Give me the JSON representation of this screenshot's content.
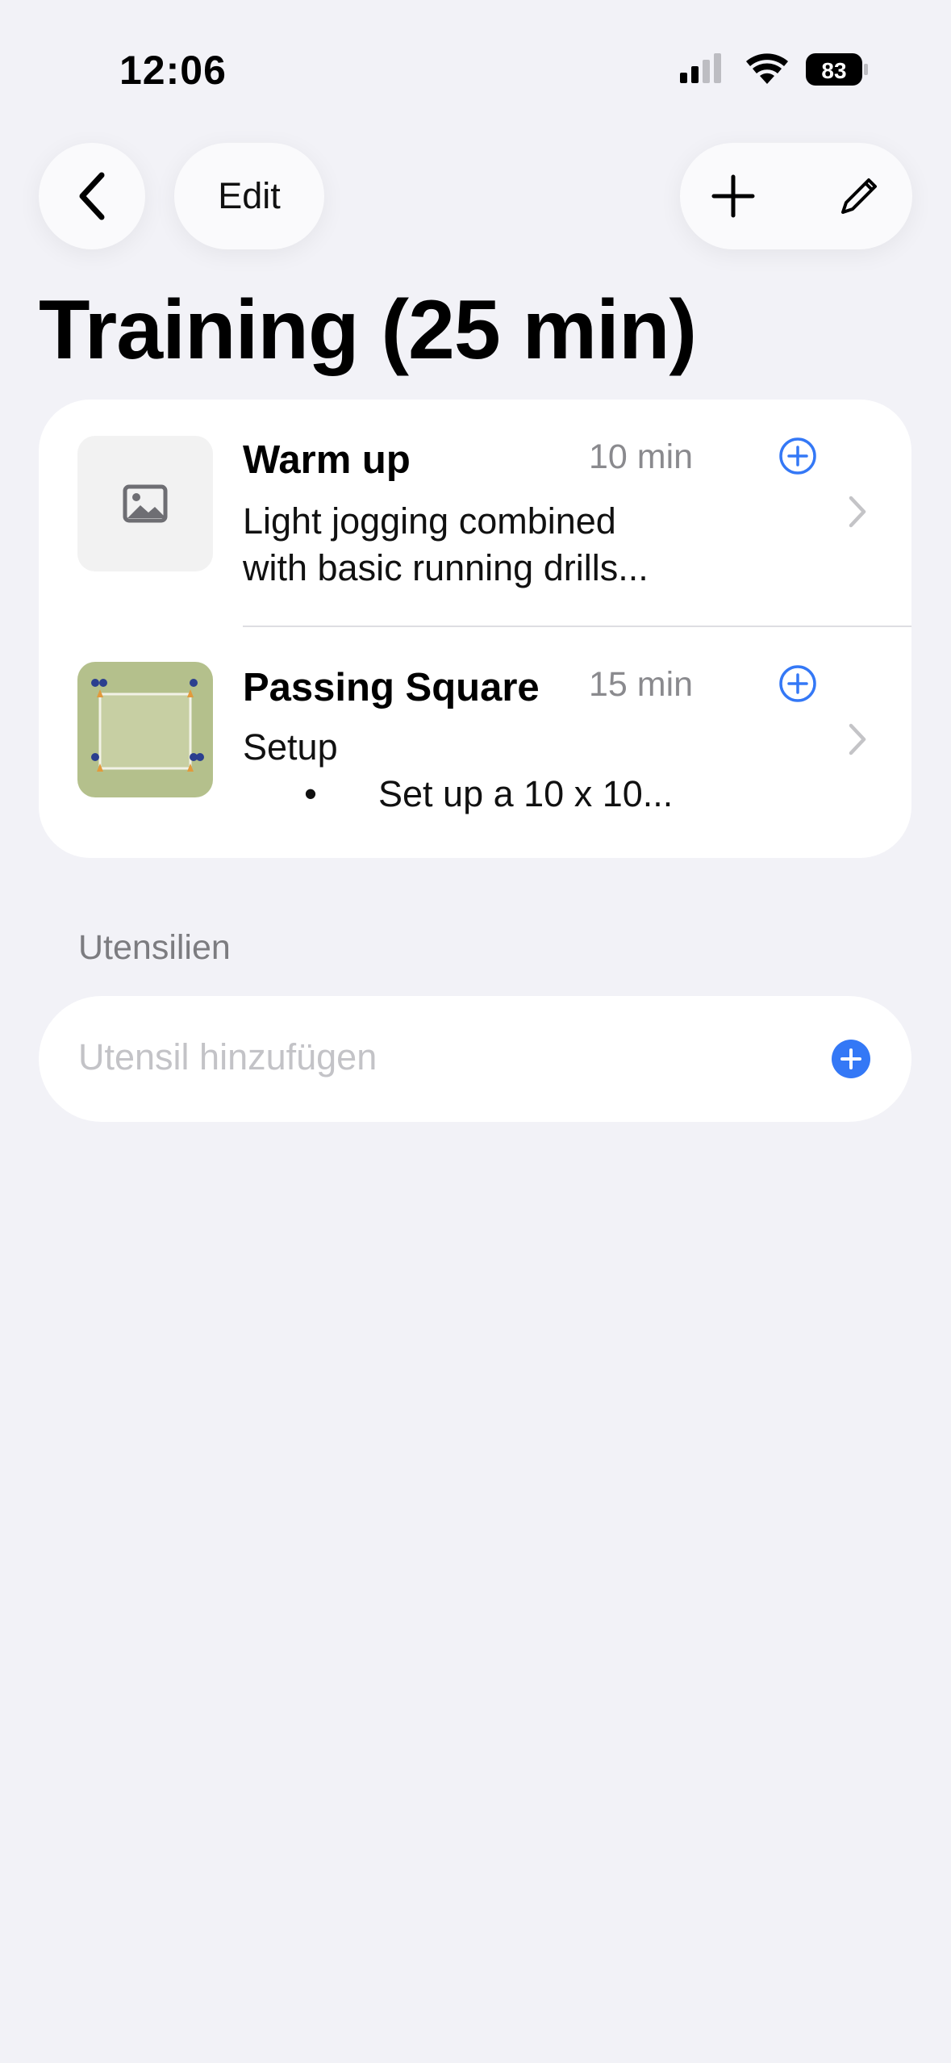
{
  "status_bar": {
    "time": "12:06",
    "battery": "83",
    "icons": [
      "cellular-signal-icon",
      "wifi-icon",
      "battery-icon"
    ]
  },
  "nav": {
    "back_icon": "chevron-left-icon",
    "edit_label": "Edit",
    "add_icon": "plus-icon",
    "pencil_icon": "pencil-icon"
  },
  "page": {
    "title": "Training (25 min)"
  },
  "exercises": [
    {
      "title": "Warm up",
      "duration": "10 min",
      "description_lines": [
        "Light jogging combined",
        "with basic running drills..."
      ],
      "thumbnail": "image-placeholder-icon"
    },
    {
      "title": "Passing Square",
      "duration": "15 min",
      "description_line1": "Setup",
      "bullet": "•",
      "bullet_text": "Set up a 10 x 10...",
      "thumbnail": "passing-square-diagram"
    }
  ],
  "equipment": {
    "section_label": "Utensilien",
    "add_placeholder": "Utensil hinzufügen"
  },
  "colors": {
    "accent": "#3478f6",
    "background": "#f2f2f7",
    "secondary_text": "#8a8a8e"
  }
}
